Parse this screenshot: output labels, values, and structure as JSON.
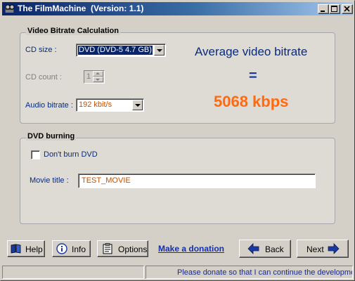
{
  "window": {
    "title": "The FilmMachine  (Version: 1.1)"
  },
  "bitrate_group": {
    "legend": "Video Bitrate Calculation",
    "cd_size_label": "CD size :",
    "cd_size_value": "DVD (DVD-5 4.7 GB)",
    "cd_count_label": "CD count :",
    "cd_count_value": "1",
    "audio_bitrate_label": "Audio bitrate :",
    "audio_bitrate_value": "192 kbit/s",
    "result_title": "Average video bitrate",
    "equals": "=",
    "result_value": "5068 kbps"
  },
  "dvd_group": {
    "legend": "DVD burning",
    "dont_burn_label": "Don't burn DVD",
    "dont_burn_checked": false,
    "movie_title_label": "Movie title :",
    "movie_title_value": "TEST_MOVIE"
  },
  "buttons": {
    "help": "Help",
    "info": "Info",
    "options": "Options",
    "donate_link": "Make a donation",
    "back": "Back",
    "next": "Next"
  },
  "status": {
    "message": "Please donate so that I can continue the developmer"
  },
  "icons": {
    "app": "film-reel-icon",
    "help": "book-icon",
    "info": "info-icon",
    "options": "clipboard-icon",
    "back": "back-arrow-icon",
    "next": "next-arrow-icon"
  },
  "colors": {
    "title_gradient_start": "#0a246a",
    "accent_blue": "#0a2a7a",
    "bitrate_orange": "#ff6a10",
    "field_text_orange": "#c05000"
  }
}
